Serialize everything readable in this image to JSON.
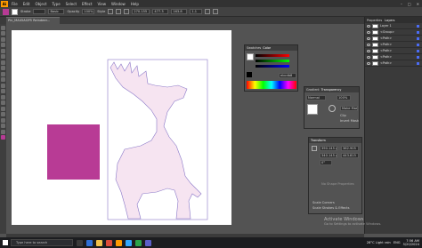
{
  "app": {
    "logo": "Ai"
  },
  "menu": {
    "items": [
      "File",
      "Edit",
      "Object",
      "Type",
      "Select",
      "Effect",
      "View",
      "Window",
      "Help"
    ]
  },
  "control_bar": {
    "selection_label": "Stroke",
    "basic_label": "Basic",
    "opacity_label": "Opacity",
    "opacity_value": "100%",
    "style_label": "Style",
    "x_value": "270.155",
    "y_value": "477.3",
    "w_value": "163.8",
    "h_value": "1.1"
  },
  "document": {
    "tab_title": "Pin_MA45AGP5 Reindeer..."
  },
  "canvas": {
    "rect_color": "#b83b95",
    "deer_fill": "#f6e4f1",
    "deer_stroke": "#8a78c8"
  },
  "color_panel": {
    "tabs": [
      "Swatches",
      "Color"
    ],
    "hex_value": "ebcdb8"
  },
  "transparency_panel": {
    "tabs": [
      "Gradient",
      "Transparency"
    ],
    "mode": "Normal",
    "opacity": "100%",
    "make_mask_label": "Make Mask",
    "clip_label": "Clip",
    "invert_label": "Invert Mask"
  },
  "transform_panel": {
    "title": "Transform",
    "x": "390.145 px",
    "y": "362.905",
    "w": "340.145 px",
    "h": "443.815",
    "angle": "0°",
    "shape_label": "No Shape Properties",
    "scale_corners_label": "Scale Corners",
    "scale_strokes_label": "Scale Strokes & Effects"
  },
  "dock": {
    "tabs": [
      "Properties",
      "Layers"
    ],
    "layers": [
      {
        "name": "Layer 1"
      },
      {
        "name": "<Group>"
      },
      {
        "name": "<Path>"
      },
      {
        "name": "<Path>"
      },
      {
        "name": "<Path>"
      },
      {
        "name": "<Path>"
      },
      {
        "name": "<Path>"
      }
    ]
  },
  "watermark": {
    "title": "Activate Windows",
    "subtitle": "Go to Settings to activate Windows."
  },
  "taskbar": {
    "search_placeholder": "Type here to search",
    "weather": "28°C Light rain",
    "lang": "ENG",
    "time": "7:56 AM",
    "date": "5/20/2024"
  }
}
